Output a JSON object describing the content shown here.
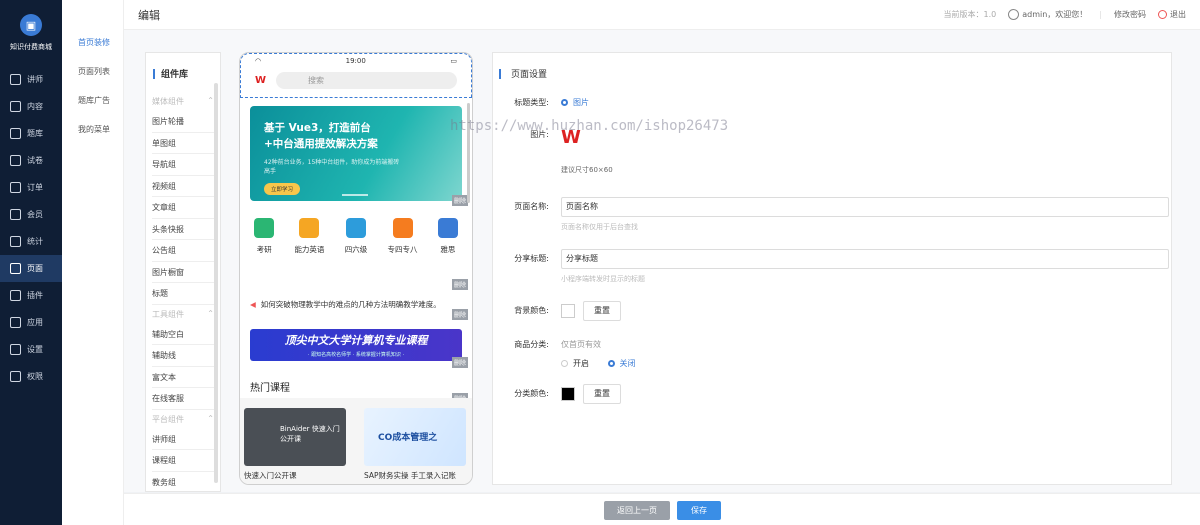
{
  "brand": {
    "name": "知识付费商城"
  },
  "nav": [
    {
      "label": "讲师"
    },
    {
      "label": "内容"
    },
    {
      "label": "题库"
    },
    {
      "label": "试卷"
    },
    {
      "label": "订单"
    },
    {
      "label": "会员"
    },
    {
      "label": "统计"
    },
    {
      "label": "页面"
    },
    {
      "label": "插件"
    },
    {
      "label": "应用"
    },
    {
      "label": "设置"
    },
    {
      "label": "权限"
    }
  ],
  "subnav": [
    {
      "label": "首页装修"
    },
    {
      "label": "页面列表"
    },
    {
      "label": "题库广告"
    },
    {
      "label": "我的菜单"
    }
  ],
  "topbar": {
    "title": "编辑",
    "version": "当前版本：1.0",
    "user": "admin，欢迎您！",
    "change_pwd": "修改密码",
    "logout": "退出"
  },
  "library": {
    "title": "组件库",
    "groups": [
      {
        "name": "媒体组件",
        "items": [
          "图片轮播",
          "单图组",
          "导航组",
          "视频组",
          "文章组",
          "头条快报",
          "公告组",
          "图片橱窗",
          "标题"
        ]
      },
      {
        "name": "工具组件",
        "items": [
          "辅助空白",
          "辅助线",
          "富文本",
          "在线客服"
        ]
      },
      {
        "name": "平台组件",
        "items": [
          "讲师组",
          "课程组",
          "教务组"
        ]
      }
    ]
  },
  "phone": {
    "time": "19:00",
    "logo": "W",
    "search_placeholder": "搜索",
    "banner": {
      "title": "基于 Vue3，打造前台+中台通用提效解决方案",
      "sub": "42种前台业务，15种中台组件，助你成为前端搬砖高手",
      "btn": "立即学习"
    },
    "delete_label": "删除",
    "icons": [
      {
        "label": "考研",
        "color": "#2bb673"
      },
      {
        "label": "能力英语",
        "color": "#f5a623"
      },
      {
        "label": "四六级",
        "color": "#2d9cdb"
      },
      {
        "label": "专四专八",
        "color": "#f57c1f"
      },
      {
        "label": "雅思",
        "color": "#3a7bd5"
      }
    ],
    "notice": "如何突破物理教学中的难点的几种方法明确教学难度。",
    "banner2": {
      "title": "顶尖中文大学计算机专业课程",
      "sub": "· 跟知名高校名师学 · 系统掌握计算机知识 ·"
    },
    "hot_title": "热门课程",
    "courses": [
      {
        "title": "快速入门公开课",
        "img_text": "BinAider 快速入门公开课"
      },
      {
        "title": "SAP财务实操 手工录入记账",
        "img_text": "CO成本管理之"
      }
    ]
  },
  "settings": {
    "title": "页面设置",
    "title_type": {
      "label": "标题类型:",
      "option": "图片"
    },
    "image": {
      "label": "图片:",
      "hint": "建议尺寸60×60"
    },
    "page_name": {
      "label": "页面名称:",
      "value": "页面名称",
      "hint": "页面名称仅用于后台查找"
    },
    "share_title": {
      "label": "分享标题:",
      "value": "分享标题",
      "hint": "小程序端转发时显示的标题"
    },
    "bg_color": {
      "label": "背景颜色:",
      "reset": "重置",
      "value": "#ffffff"
    },
    "category": {
      "label": "商品分类:",
      "hint": "仅首页有效",
      "on": "开启",
      "off": "关闭"
    },
    "cat_color": {
      "label": "分类颜色:",
      "reset": "重置",
      "value": "#000000"
    }
  },
  "footer": {
    "back": "返回上一页",
    "save": "保存"
  },
  "watermark": "https://www.huzhan.com/ishop26473"
}
